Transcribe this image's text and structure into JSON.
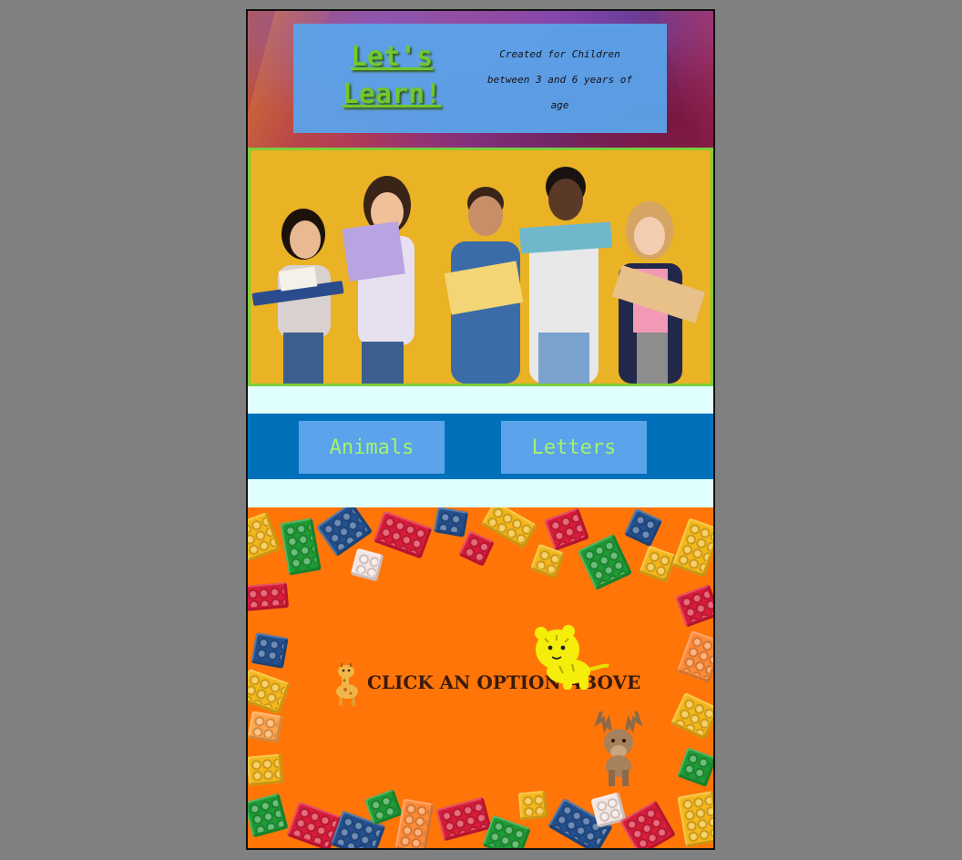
{
  "header": {
    "title": "Let's Learn!",
    "tagline": "Created for Children between 3 and 6 years of age"
  },
  "hero": {
    "image": "children-reading-books-photo"
  },
  "nav": {
    "buttons": [
      {
        "label": "Animals"
      },
      {
        "label": "Letters"
      }
    ]
  },
  "content": {
    "prompt": "CLICK AN OPTION ABOVE",
    "decorations": [
      "giraffe-icon",
      "tiger-icon",
      "moose-icon"
    ]
  },
  "colors": {
    "page_bg": "#808080",
    "header_box": "#5ba3ea",
    "title": "#6fcf2c",
    "nav_bar": "#0070bb",
    "nav_button": "#5ba3ea",
    "nav_text": "#a4f26e",
    "content_bg": "#ff7508",
    "hero_border": "#7ccf3a",
    "hero_bg": "#eab225"
  }
}
